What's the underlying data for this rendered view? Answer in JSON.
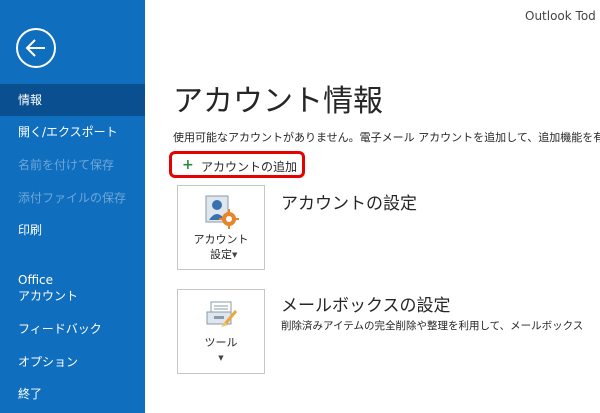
{
  "window": {
    "app_title": "Outlook Tod"
  },
  "sidebar": {
    "items": [
      {
        "label": "情報",
        "state": "active"
      },
      {
        "label": "開く/エクスポート",
        "state": "normal"
      },
      {
        "label": "名前を付けて保存",
        "state": "disabled"
      },
      {
        "label": "添付ファイルの保存",
        "state": "disabled"
      },
      {
        "label": "印刷",
        "state": "normal"
      },
      {
        "label_line1": "Office",
        "label_line2": "アカウント",
        "state": "normal"
      },
      {
        "label": "フィードバック",
        "state": "normal"
      },
      {
        "label": "オプション",
        "state": "normal"
      },
      {
        "label": "終了",
        "state": "normal"
      }
    ],
    "back_icon": "back-arrow-circle-icon",
    "colors": {
      "background": "#106ebe",
      "active": "#0a4f8f"
    }
  },
  "main": {
    "title": "アカウント情報",
    "subtitle": "使用可能なアカウントがありません。電子メール アカウントを追加して、追加機能を有",
    "add_account_button": {
      "icon": "plus-icon",
      "label": "アカウントの追加",
      "highlight_color": "#e60000"
    },
    "sections": [
      {
        "tile_label_line1": "アカウント",
        "tile_label_line2": "設定",
        "tile_icon": "account-settings-icon",
        "title": "アカウントの設定",
        "description": ""
      },
      {
        "tile_label_line1": "ツール",
        "tile_icon": "mailbox-tools-icon",
        "title": "メールボックスの設定",
        "description": "削除済みアイテムの完全削除や整理を利用して、メールボックス"
      }
    ]
  }
}
